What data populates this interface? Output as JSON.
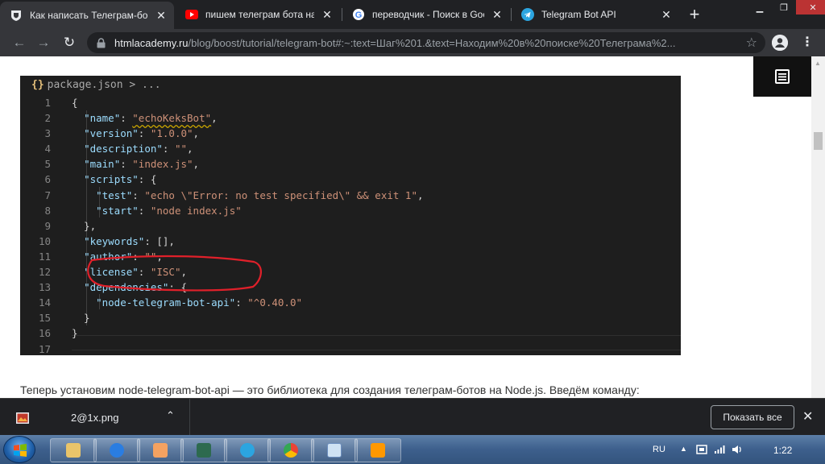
{
  "browser": {
    "tabs": [
      {
        "title": "Как написать Телеграм-бо",
        "favicon": "htmlacademy-shield-icon",
        "active": true
      },
      {
        "title": "пишем телеграм бота на j",
        "favicon": "youtube-icon",
        "active": false
      },
      {
        "title": "переводчик - Поиск в Goo",
        "favicon": "google-g-icon",
        "active": false
      },
      {
        "title": "Telegram Bot API",
        "favicon": "telegram-icon",
        "active": false
      }
    ],
    "url_host": "htmlacademy.ru",
    "url_path": "/blog/boost/tutorial/telegram-bot#:~:text=Шаг%201.&text=Находим%20в%20поиске%20Телеграма%2..."
  },
  "editor": {
    "breadcrumb_file": "package.json",
    "breadcrumb_tail": " > ...",
    "lines": [
      {
        "n": "1",
        "t": [
          [
            "p",
            "{"
          ]
        ]
      },
      {
        "n": "2",
        "t": [
          [
            "p",
            "  "
          ],
          [
            "k",
            "\"name\""
          ],
          [
            "p",
            ": "
          ],
          [
            "s",
            "\"echoKeksBot\""
          ],
          [
            "p",
            ","
          ]
        ]
      },
      {
        "n": "3",
        "t": [
          [
            "p",
            "  "
          ],
          [
            "k",
            "\"version\""
          ],
          [
            "p",
            ": "
          ],
          [
            "s",
            "\"1.0.0\""
          ],
          [
            "p",
            ","
          ]
        ]
      },
      {
        "n": "4",
        "t": [
          [
            "p",
            "  "
          ],
          [
            "k",
            "\"description\""
          ],
          [
            "p",
            ": "
          ],
          [
            "s",
            "\"\""
          ],
          [
            "p",
            ","
          ]
        ]
      },
      {
        "n": "5",
        "t": [
          [
            "p",
            "  "
          ],
          [
            "k",
            "\"main\""
          ],
          [
            "p",
            ": "
          ],
          [
            "s",
            "\"index.js\""
          ],
          [
            "p",
            ","
          ]
        ]
      },
      {
        "n": "6",
        "t": [
          [
            "p",
            "  "
          ],
          [
            "k",
            "\"scripts\""
          ],
          [
            "p",
            ": {"
          ]
        ]
      },
      {
        "n": "7",
        "t": [
          [
            "p",
            "    "
          ],
          [
            "k",
            "\"test\""
          ],
          [
            "p",
            ": "
          ],
          [
            "s",
            "\"echo \\\"Error: no test specified\\\" && exit 1\""
          ],
          [
            "p",
            ","
          ]
        ]
      },
      {
        "n": "8",
        "t": [
          [
            "p",
            "    "
          ],
          [
            "k",
            "\"start\""
          ],
          [
            "p",
            ": "
          ],
          [
            "s",
            "\"node index.js\""
          ]
        ]
      },
      {
        "n": "9",
        "t": [
          [
            "p",
            "  },"
          ]
        ]
      },
      {
        "n": "10",
        "t": [
          [
            "p",
            "  "
          ],
          [
            "k",
            "\"keywords\""
          ],
          [
            "p",
            ": [],"
          ]
        ]
      },
      {
        "n": "11",
        "t": [
          [
            "p",
            "  "
          ],
          [
            "k",
            "\"author\""
          ],
          [
            "p",
            ": "
          ],
          [
            "s",
            "\"\""
          ],
          [
            "p",
            ","
          ]
        ]
      },
      {
        "n": "12",
        "t": [
          [
            "p",
            "  "
          ],
          [
            "k",
            "\"license\""
          ],
          [
            "p",
            ": "
          ],
          [
            "s",
            "\"ISC\""
          ],
          [
            "p",
            ","
          ]
        ]
      },
      {
        "n": "13",
        "t": [
          [
            "p",
            "  "
          ],
          [
            "k",
            "\"dependencies\""
          ],
          [
            "p",
            ": {"
          ]
        ]
      },
      {
        "n": "14",
        "t": [
          [
            "p",
            "    "
          ],
          [
            "k",
            "\"node-telegram-bot-api\""
          ],
          [
            "p",
            ": "
          ],
          [
            "s",
            "\"^0.40.0\""
          ]
        ]
      },
      {
        "n": "15",
        "t": [
          [
            "p",
            "  }"
          ]
        ]
      },
      {
        "n": "16",
        "t": [
          [
            "p",
            "}"
          ]
        ]
      },
      {
        "n": "17",
        "t": []
      }
    ]
  },
  "article": {
    "paragraph": "Теперь установим node-telegram-bot-api — это библиотека для создания телеграм-ботов на Node.js. Введём команду:"
  },
  "downloads": {
    "file_name": "2@1x.png",
    "show_all": "Показать все"
  },
  "taskbar": {
    "language": "RU",
    "clock": "1:22"
  },
  "colors": {
    "editor_bg": "#1e1e1e",
    "json_key": "#9cdcfe",
    "json_string": "#ce9178",
    "annotation_red": "#e0202a"
  }
}
